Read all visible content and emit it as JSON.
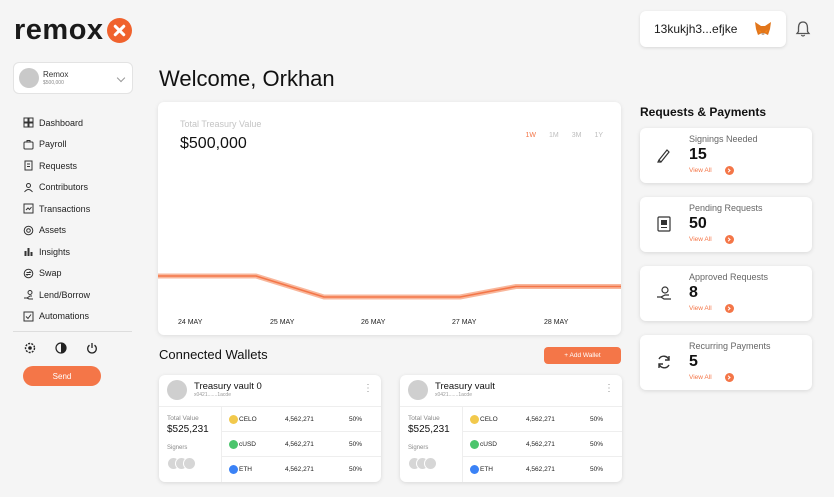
{
  "brand": {
    "name": "remox"
  },
  "header": {
    "wallet_address": "13kukjh3...efjke"
  },
  "account": {
    "name": "Remox",
    "balance": "$500,000"
  },
  "sidebar": {
    "items": [
      {
        "label": "Dashboard",
        "icon": "dashboard-icon"
      },
      {
        "label": "Payroll",
        "icon": "payroll-icon"
      },
      {
        "label": "Requests",
        "icon": "requests-icon"
      },
      {
        "label": "Contributors",
        "icon": "contributors-icon"
      },
      {
        "label": "Transactions",
        "icon": "transactions-icon"
      },
      {
        "label": "Assets",
        "icon": "assets-icon"
      },
      {
        "label": "Insights",
        "icon": "insights-icon"
      },
      {
        "label": "Swap",
        "icon": "swap-icon"
      },
      {
        "label": "Lend/Borrow",
        "icon": "lend-borrow-icon"
      },
      {
        "label": "Automations",
        "icon": "automations-icon"
      }
    ],
    "send_label": "Send"
  },
  "main": {
    "welcome": "Welcome, Orkhan",
    "treasury": {
      "label": "Total Treasury Value",
      "value": "$500,000",
      "ranges": [
        "1W",
        "1M",
        "3M",
        "1Y"
      ],
      "active_range": "1W"
    },
    "connected_wallets_title": "Connected Wallets",
    "add_wallet_label": "+ Add Wallet",
    "wallets": [
      {
        "name": "Treasury vault  0",
        "address": "x0421.......1acde",
        "total_label": "Total Value",
        "total_value": "$525,231",
        "signers_label": "Signers",
        "assets": [
          {
            "coin": "CELO",
            "amount": "4,562,271",
            "percent": "50%"
          },
          {
            "coin": "cUSD",
            "amount": "4,562,271",
            "percent": "50%"
          },
          {
            "coin": "ETH",
            "amount": "4,562,271",
            "percent": "50%"
          }
        ]
      },
      {
        "name": "Treasury vault",
        "address": "x0421.......1acde",
        "total_label": "Total Value",
        "total_value": "$525,231",
        "signers_label": "Signers",
        "assets": [
          {
            "coin": "CELO",
            "amount": "4,562,271",
            "percent": "50%"
          },
          {
            "coin": "cUSD",
            "amount": "4,562,271",
            "percent": "50%"
          },
          {
            "coin": "ETH",
            "amount": "4,562,271",
            "percent": "50%"
          }
        ]
      }
    ]
  },
  "requests_payments": {
    "title": "Requests & Payments",
    "cards": [
      {
        "label": "Signings Needed",
        "count": "15",
        "link": "View All",
        "icon": "pen-icon"
      },
      {
        "label": "Pending Requests",
        "count": "50",
        "link": "View All",
        "icon": "pending-icon"
      },
      {
        "label": "Approved Requests",
        "count": "8",
        "link": "View All",
        "icon": "approved-icon"
      },
      {
        "label": "Recurring Payments",
        "count": "5",
        "link": "View All",
        "icon": "recurring-icon"
      }
    ]
  },
  "colors": {
    "accent": "#f47648",
    "brand": "#f0622d",
    "celo": "#f2c94c",
    "cusd": "#4cc56d",
    "eth": "#3b82f6"
  },
  "chart_data": {
    "type": "line",
    "title": "Total Treasury Value",
    "x": [
      "24 MAY",
      "25 MAY",
      "26 MAY",
      "27 MAY",
      "28 MAY"
    ],
    "series": [
      {
        "values": [
          3,
          3,
          1,
          1,
          2
        ]
      }
    ],
    "y_ticks_shown": false,
    "grid": false
  }
}
